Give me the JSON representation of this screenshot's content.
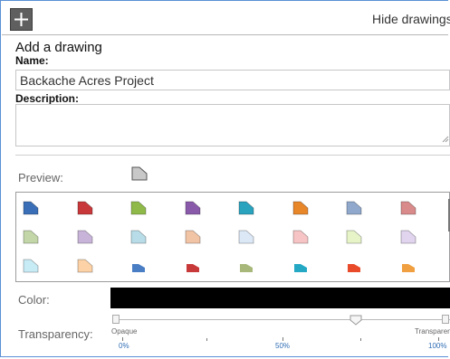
{
  "toolbar": {
    "add_icon": "plus-icon",
    "hide_drawings_label": "Hide drawings"
  },
  "form": {
    "section_title": "Add a drawing",
    "name_label": "Name:",
    "name_value": "Backache Acres Project",
    "description_label": "Description:",
    "description_value": ""
  },
  "preview": {
    "label": "Preview:",
    "color": "#c8c8c8"
  },
  "palette": {
    "rows": [
      [
        "#3a6fb8",
        "#c8383a",
        "#8fba4a",
        "#8a5aaa",
        "#2aa3bf",
        "#e8862a",
        "#8fa8cc",
        "#d98a8a"
      ],
      [
        "#c2d6a8",
        "#c8b4d8",
        "#b8dde8",
        "#f2c4a6",
        "#dce8f6",
        "#f6c4c4",
        "#e6f4c8",
        "#e0d4ee"
      ],
      [
        "#c8ecf6",
        "#fcd2a6",
        "#4a7ec4",
        "#c83a3a",
        "#a8b87a",
        "#24a8c4",
        "#e84a2a",
        "#f0a040"
      ]
    ]
  },
  "color": {
    "label": "Color:",
    "value": "#000000"
  },
  "transparency": {
    "label": "Transparency:",
    "opaque_label": "Opaque",
    "transparent_label": "Transparent",
    "pct_min": "0%",
    "pct_mid": "50%",
    "pct_max": "100%",
    "value_fraction": 0.73
  }
}
